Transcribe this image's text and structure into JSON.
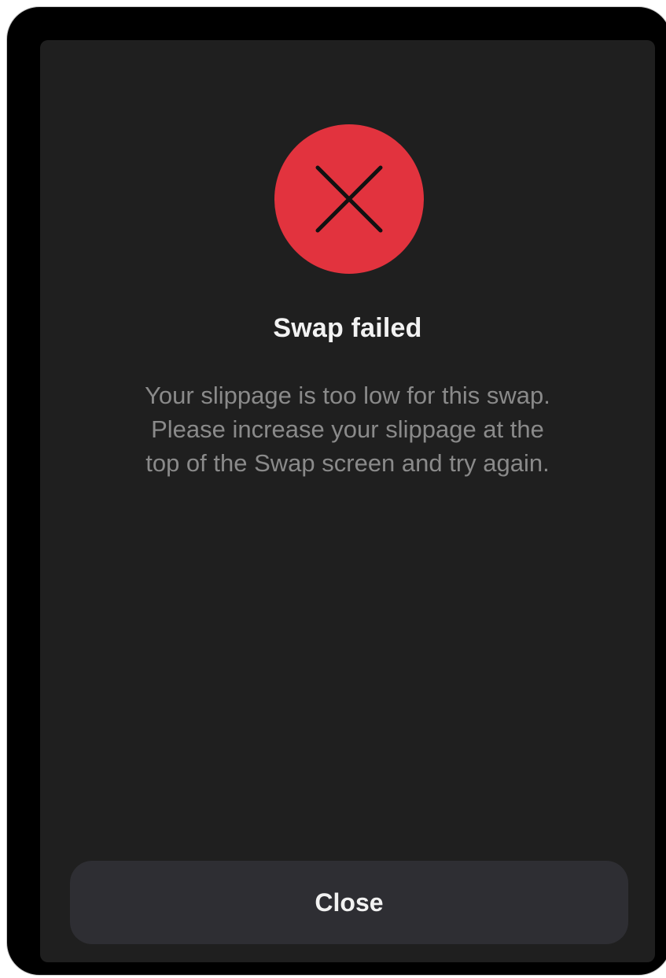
{
  "dialog": {
    "icon": "close-x-icon",
    "icon_color": "#e2333e",
    "title": "Swap failed",
    "message_lines": [
      "Your slippage is too low for this swap.",
      "Please increase your slippage at the",
      "top of the Swap screen and try again."
    ],
    "close_label": "Close"
  }
}
